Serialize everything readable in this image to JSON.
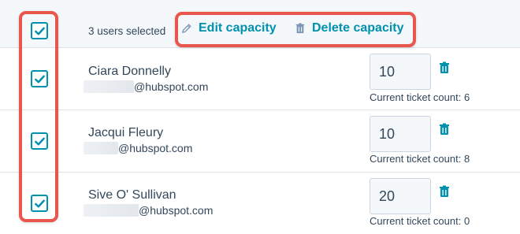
{
  "header": {
    "selected_text": "3 users selected",
    "edit_label": "Edit capacity",
    "delete_label": "Delete capacity"
  },
  "users": [
    {
      "name": "Ciara Donnelly",
      "email_domain": "@hubspot.com",
      "capacity": "10",
      "ticket_count_label": "Current ticket count: 6"
    },
    {
      "name": "Jacqui Fleury",
      "email_domain": "@hubspot.com",
      "capacity": "10",
      "ticket_count_label": "Current ticket count: 8"
    },
    {
      "name": "Sive O' Sullivan",
      "email_domain": "@hubspot.com",
      "capacity": "20",
      "ticket_count_label": "Current ticket count: 0"
    }
  ],
  "colors": {
    "accent": "#0091ae",
    "highlight": "#e8564d",
    "text": "#33475b"
  },
  "icons": {
    "edit": "pencil-icon",
    "delete": "trash-icon",
    "checkbox": "checkmark-icon"
  }
}
